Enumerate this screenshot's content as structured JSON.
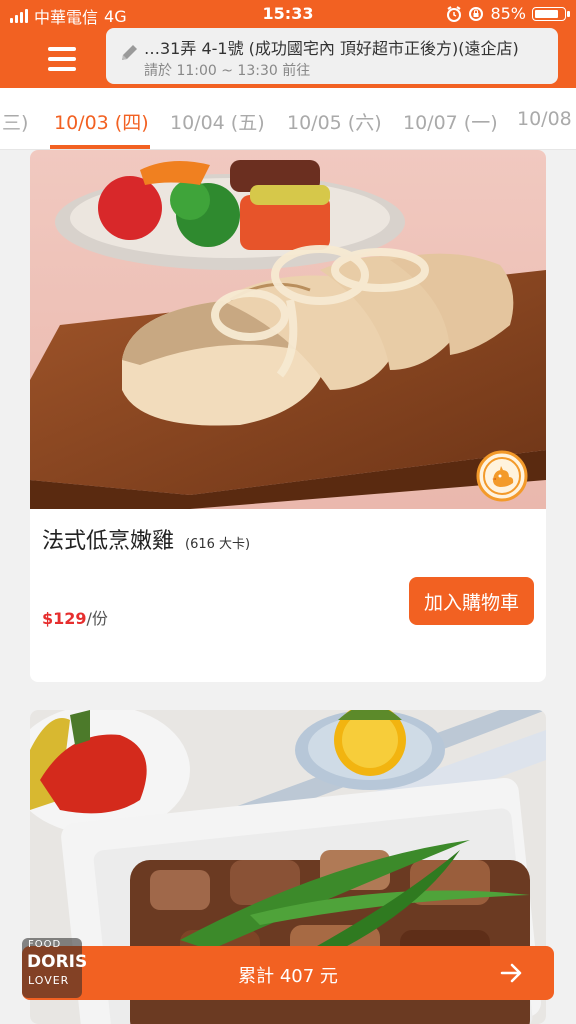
{
  "status_bar": {
    "carrier": "中華電信",
    "network": "4G",
    "time": "15:33",
    "battery": "85%",
    "battery_level": 0.85
  },
  "header": {
    "address": "…31弄 4-1號 (成功國宅內 頂好超市正後方)(遠企店)",
    "pickup_time": "請於 11:00 ~ 13:30 前往",
    "menu_icon": "hamburger-menu-icon",
    "edit_icon": "pencil-icon"
  },
  "tabs": [
    {
      "label": "三)",
      "active": false
    },
    {
      "label": "10/03 (四)",
      "active": true
    },
    {
      "label": "10/04 (五)",
      "active": false
    },
    {
      "label": "10/05 (六)",
      "active": false
    },
    {
      "label": "10/07 (一)",
      "active": false
    },
    {
      "label": "10/08",
      "active": false
    }
  ],
  "products": [
    {
      "name": "法式低烹嫩雞",
      "kcal": "(616 大卡)",
      "price": "$129",
      "unit": "/份",
      "button": "加入購物車",
      "badge_icon": "chick-icon"
    }
  ],
  "cart": {
    "total": "累計 407 元",
    "arrow_icon": "arrow-right-icon"
  },
  "logo": {
    "line1": "FOOD",
    "line2": "DORIS",
    "line3": "LOVER"
  },
  "colors": {
    "accent": "#f26122",
    "price": "#e62e2e"
  }
}
